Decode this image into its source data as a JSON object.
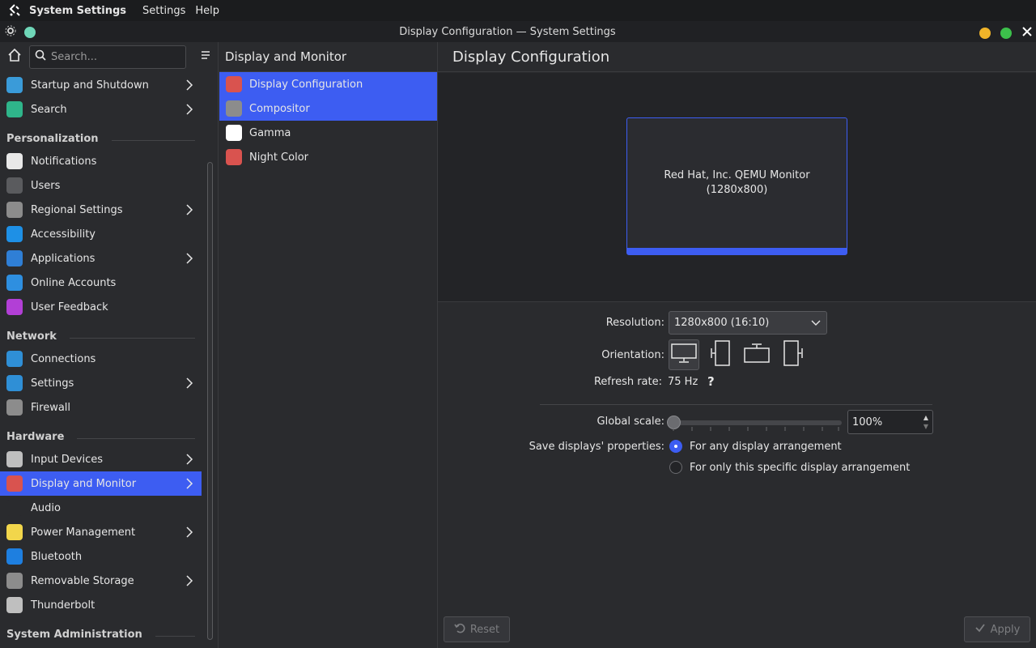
{
  "menubar": {
    "app_name": "System Settings",
    "menus": [
      "Settings",
      "Help"
    ]
  },
  "titlebar": {
    "title": "Display Configuration — System Settings"
  },
  "sidebar": {
    "search_placeholder": "Search...",
    "sections": [
      {
        "heading": "",
        "items": [
          {
            "label": "Startup and Shutdown",
            "icon": "startup-icon",
            "color": "#3a9bd9",
            "chevron": true
          },
          {
            "label": "Search",
            "icon": "search-app-icon",
            "color": "#2fb58a",
            "chevron": true
          }
        ]
      },
      {
        "heading": "Personalization",
        "items": [
          {
            "label": "Notifications",
            "icon": "notifications-icon",
            "color": "#e8e8e8",
            "chevron": false
          },
          {
            "label": "Users",
            "icon": "users-icon",
            "color": "#5a5b5e",
            "chevron": false
          },
          {
            "label": "Regional Settings",
            "icon": "regional-icon",
            "color": "#8c8c8c",
            "chevron": true
          },
          {
            "label": "Accessibility",
            "icon": "accessibility-icon",
            "color": "#1e90e6",
            "chevron": false
          },
          {
            "label": "Applications",
            "icon": "applications-icon",
            "color": "#2f7fd6",
            "chevron": true
          },
          {
            "label": "Online Accounts",
            "icon": "cloud-icon",
            "color": "#2e8fe0",
            "chevron": false
          },
          {
            "label": "User Feedback",
            "icon": "feedback-icon",
            "color": "#b23fd6",
            "chevron": false
          }
        ]
      },
      {
        "heading": "Network",
        "items": [
          {
            "label": "Connections",
            "icon": "connections-icon",
            "color": "#2f8fd6",
            "chevron": false
          },
          {
            "label": "Settings",
            "icon": "network-settings-icon",
            "color": "#2f8fd6",
            "chevron": true
          },
          {
            "label": "Firewall",
            "icon": "firewall-icon",
            "color": "#8c8c8c",
            "chevron": false
          }
        ]
      },
      {
        "heading": "Hardware",
        "items": [
          {
            "label": "Input Devices",
            "icon": "input-devices-icon",
            "color": "#bfbfbf",
            "chevron": true
          },
          {
            "label": "Display and Monitor",
            "icon": "display-icon",
            "color": "#d9534f",
            "chevron": true,
            "selected": true
          },
          {
            "label": "Audio",
            "icon": "audio-icon",
            "color": "#2a2b2e",
            "chevron": false
          },
          {
            "label": "Power Management",
            "icon": "power-icon",
            "color": "#f2d64b",
            "chevron": true
          },
          {
            "label": "Bluetooth",
            "icon": "bluetooth-icon",
            "color": "#1e7fe0",
            "chevron": false
          },
          {
            "label": "Removable Storage",
            "icon": "storage-icon",
            "color": "#8c8c8c",
            "chevron": true
          },
          {
            "label": "Thunderbolt",
            "icon": "thunderbolt-icon",
            "color": "#bfbfbf",
            "chevron": false
          }
        ]
      },
      {
        "heading": "System Administration",
        "items": []
      }
    ]
  },
  "middle": {
    "title": "Display and Monitor",
    "items": [
      {
        "label": "Display Configuration",
        "icon": "display-config-icon",
        "color": "#d9534f",
        "selected": true
      },
      {
        "label": "Compositor",
        "icon": "compositor-icon",
        "color": "#8c8c8c",
        "selected": true
      },
      {
        "label": "Gamma",
        "icon": "gamma-icon",
        "color": "#ffffff",
        "selected": false
      },
      {
        "label": "Night Color",
        "icon": "night-color-icon",
        "color": "#d9534f",
        "selected": false
      }
    ]
  },
  "main": {
    "title": "Display Configuration",
    "monitor_name": "Red Hat, Inc. QEMU Monitor",
    "monitor_resolution": "(1280x800)",
    "resolution_label": "Resolution:",
    "resolution_value": "1280x800 (16:10)",
    "orientation_label": "Orientation:",
    "refresh_label": "Refresh rate:",
    "refresh_value": "75 Hz",
    "help_glyph": "?",
    "global_scale_label": "Global scale:",
    "global_scale_value": "100%",
    "global_scale_fraction": 0,
    "save_label": "Save displays' properties:",
    "save_options": [
      {
        "label": "For any display arrangement",
        "checked": true
      },
      {
        "label": "For only this specific display arrangement",
        "checked": false
      }
    ],
    "reset_label": "Reset",
    "apply_label": "Apply"
  },
  "colors": {
    "accent": "#3d5df2",
    "window_min": "#f0b429",
    "window_max": "#3cc04b",
    "app_dot": "#6fd6b8"
  }
}
